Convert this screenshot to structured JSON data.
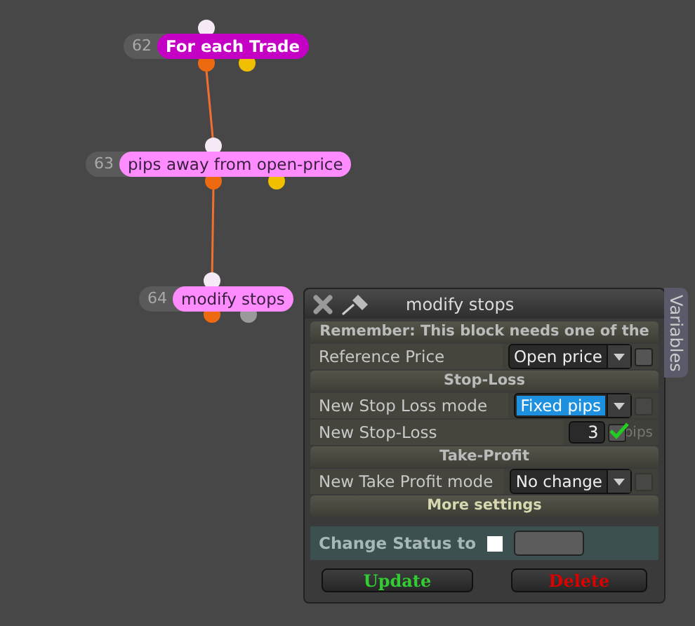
{
  "nodes": [
    {
      "number": "62",
      "label": "For each Trade",
      "color": "#c400c4",
      "bold": true,
      "ports": [
        {
          "color": "#f5e9f5"
        },
        {
          "color": "#ee6a10"
        },
        {
          "color": "#f0c000"
        }
      ]
    },
    {
      "number": "63",
      "label": "pips away from open-price",
      "color": "#ff8cff",
      "bold": false,
      "ports": [
        {
          "color": "#f5e9f5"
        },
        {
          "color": "#ee6a10"
        },
        {
          "color": "#f0c000"
        }
      ]
    },
    {
      "number": "64",
      "label": "modify stops",
      "color": "#ff8cff",
      "bold": false,
      "ports": [
        {
          "color": "#f5e9f5"
        },
        {
          "color": "#ee6a10"
        },
        {
          "color": "#9a9a9a"
        }
      ]
    }
  ],
  "panel": {
    "title": "modify stops",
    "side_tab": "Variables",
    "sections": [
      {
        "title": "Remember: This block needs one of the",
        "rows": [
          {
            "label": "Reference Price",
            "kind": "dropdown",
            "value": "Open price",
            "selected": false,
            "checked": false,
            "disabled": false
          }
        ]
      },
      {
        "title": "Stop-Loss",
        "rows": [
          {
            "label": "New Stop Loss mode",
            "kind": "dropdown",
            "value": "Fixed pips",
            "selected": true,
            "checked": false,
            "disabled": true
          },
          {
            "label": "New Stop-Loss",
            "kind": "number",
            "value": "3",
            "unit": "pips",
            "checked": true,
            "disabled": false
          }
        ]
      },
      {
        "title": "Take-Profit",
        "rows": [
          {
            "label": "New Take Profit mode",
            "kind": "dropdown",
            "value": "No change",
            "selected": false,
            "checked": false,
            "disabled": true
          }
        ]
      },
      {
        "title": "More settings"
      }
    ],
    "status": {
      "label": "Change Status to",
      "checked": false
    },
    "buttons": [
      {
        "label": "Update",
        "kind": "confirm"
      },
      {
        "label": "Delete",
        "kind": "danger"
      }
    ]
  }
}
